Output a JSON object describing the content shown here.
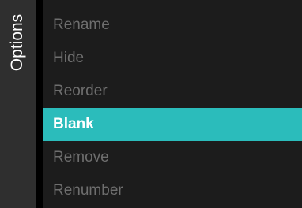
{
  "sidebar": {
    "title": "Options"
  },
  "menu": {
    "selected_index": 3,
    "items": [
      {
        "label": "Rename"
      },
      {
        "label": "Hide"
      },
      {
        "label": "Reorder"
      },
      {
        "label": "Blank"
      },
      {
        "label": "Remove"
      },
      {
        "label": "Renumber"
      }
    ]
  },
  "colors": {
    "highlight": "#2bbcbb",
    "sidebar_bg": "#2f2f2f",
    "panel_bg": "#1c1c1c",
    "inactive_text": "#6e6e6e",
    "active_text": "#ffffff"
  }
}
